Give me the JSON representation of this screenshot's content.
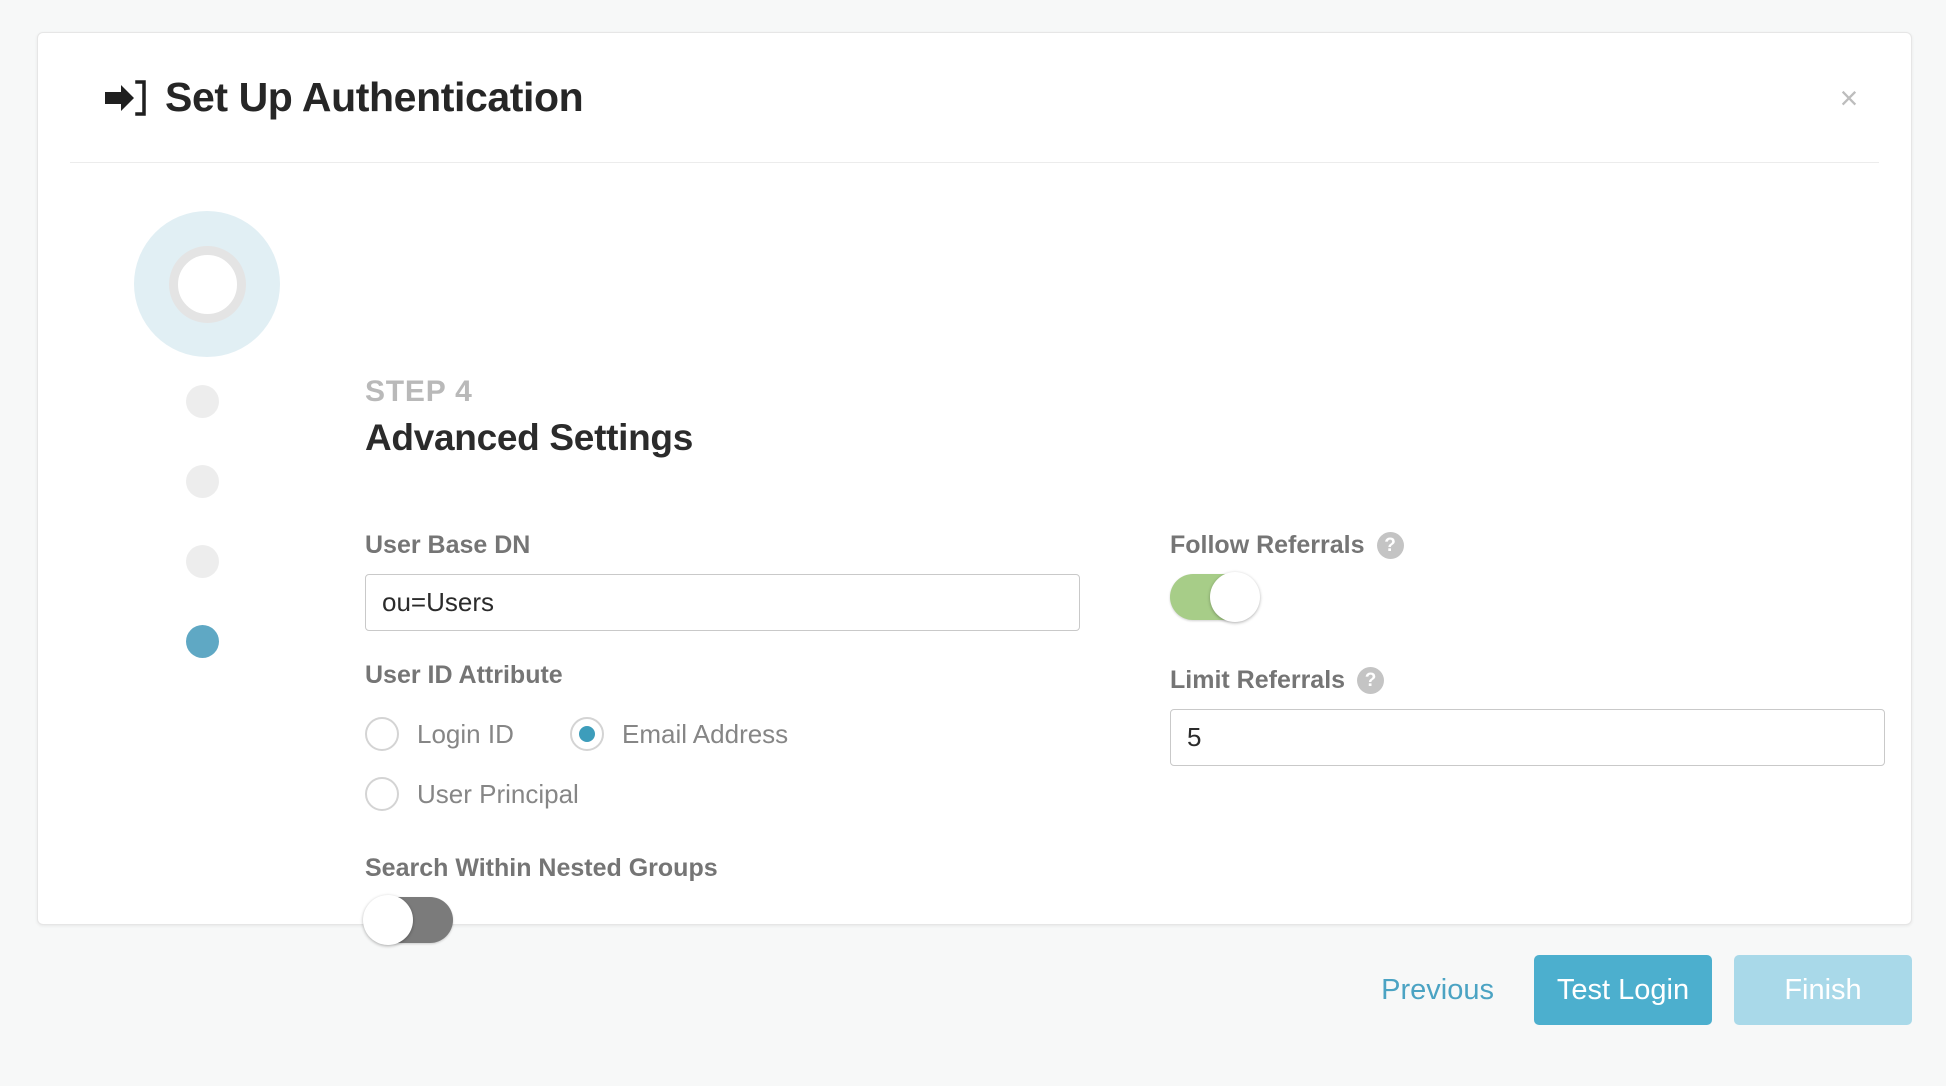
{
  "dialog": {
    "title": "Set Up Authentication",
    "title_icon": "sign-in-arrow-icon",
    "close_label": "×"
  },
  "wizard": {
    "step_eyebrow": "STEP 4",
    "step_name": "Advanced Settings",
    "total_steps": 4,
    "current_step": 4,
    "accent_color": "#5fa8c4",
    "halo_color": "#e1eff4",
    "inactive_dot_color": "#ededed"
  },
  "form": {
    "user_base_dn": {
      "label": "User Base DN",
      "value": "ou=Users",
      "placeholder": ""
    },
    "user_id_attribute": {
      "label": "User ID Attribute",
      "selected": "Email Address",
      "options": [
        {
          "label": "Login ID",
          "selected": false
        },
        {
          "label": "Email Address",
          "selected": true
        },
        {
          "label": "User Principal",
          "selected": false
        }
      ],
      "selected_color": "#3d9dbb"
    },
    "search_nested_groups": {
      "label": "Search Within Nested Groups",
      "state": "off",
      "off_color": "#7b7b7b"
    },
    "follow_referrals": {
      "label": "Follow Referrals",
      "help": "?",
      "state": "on",
      "on_color": "#a7cd88"
    },
    "limit_referrals": {
      "label": "Limit Referrals",
      "help": "?",
      "value": "5",
      "placeholder": ""
    }
  },
  "footer": {
    "previous_label": "Previous",
    "test_login_label": "Test Login",
    "finish_label": "Finish",
    "primary_color": "#4cafce",
    "disabled_color": "#a9d9e9",
    "link_color": "#4ba3c3"
  }
}
